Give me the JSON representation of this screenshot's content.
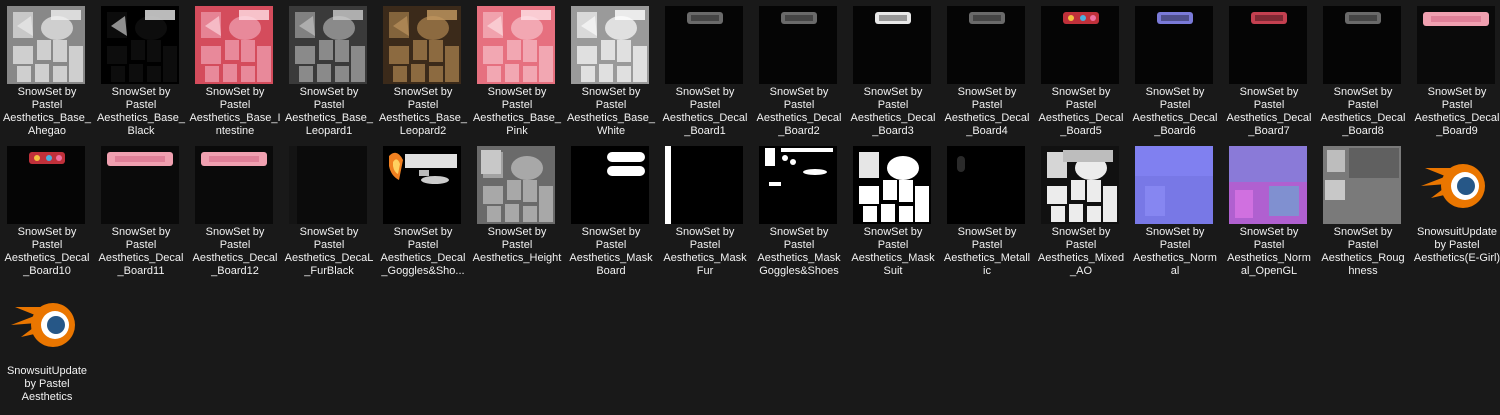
{
  "colors": {
    "background": "#191919",
    "text": "#f2f2f2",
    "blender_orange": "#ea7600",
    "blender_blue": "#265787"
  },
  "files": [
    {
      "name": "SnowSet by Pastel Aesthetics_Base_Ahegao",
      "label": "SnowSet by\nPastel\nAesthetics_Base_\nAhegao",
      "thumb": "texture-gray",
      "icon": "image-thumbnail-icon"
    },
    {
      "name": "SnowSet by Pastel Aesthetics_Base_Black",
      "label": "SnowSet by\nPastel\nAesthetics_Base_\nBlack",
      "thumb": "texture-black",
      "icon": "image-thumbnail-icon"
    },
    {
      "name": "SnowSet by Pastel Aesthetics_Base_Intestine",
      "label": "SnowSet by\nPastel\nAesthetics_Base_I\nntestine",
      "thumb": "texture-red",
      "icon": "image-thumbnail-icon"
    },
    {
      "name": "SnowSet by Pastel Aesthetics_Base_Leopard1",
      "label": "SnowSet by\nPastel\nAesthetics_Base_\nLeopard1",
      "thumb": "texture-darkgray",
      "icon": "image-thumbnail-icon"
    },
    {
      "name": "SnowSet by Pastel Aesthetics_Base_Leopard2",
      "label": "SnowSet by\nPastel\nAesthetics_Base_\nLeopard2",
      "thumb": "texture-brown",
      "icon": "image-thumbnail-icon"
    },
    {
      "name": "SnowSet by Pastel Aesthetics_Base_Pink",
      "label": "SnowSet by\nPastel\nAesthetics_Base_\nPink",
      "thumb": "texture-pink",
      "icon": "image-thumbnail-icon"
    },
    {
      "name": "SnowSet by Pastel Aesthetics_Base_White",
      "label": "SnowSet by\nPastel\nAesthetics_Base_\nWhite",
      "thumb": "texture-white",
      "icon": "image-thumbnail-icon"
    },
    {
      "name": "SnowSet by Pastel Aesthetics_Decal_Board1",
      "label": "SnowSet by\nPastel\nAesthetics_Decal\n_Board1",
      "thumb": "decal-dark",
      "icon": "image-thumbnail-icon"
    },
    {
      "name": "SnowSet by Pastel Aesthetics_Decal_Board2",
      "label": "SnowSet by\nPastel\nAesthetics_Decal\n_Board2",
      "thumb": "decal-dark",
      "icon": "image-thumbnail-icon"
    },
    {
      "name": "SnowSet by Pastel Aesthetics_Decal_Board3",
      "label": "SnowSet by\nPastel\nAesthetics_Decal\n_Board3",
      "thumb": "decal-white",
      "icon": "image-thumbnail-icon"
    },
    {
      "name": "SnowSet by Pastel Aesthetics_Decal_Board4",
      "label": "SnowSet by\nPastel\nAesthetics_Decal\n_Board4",
      "thumb": "decal-dark",
      "icon": "image-thumbnail-icon"
    },
    {
      "name": "SnowSet by Pastel Aesthetics_Decal_Board5",
      "label": "SnowSet by\nPastel\nAesthetics_Decal\n_Board5",
      "thumb": "decal-color",
      "icon": "image-thumbnail-icon"
    },
    {
      "name": "SnowSet by Pastel Aesthetics_Decal_Board6",
      "label": "SnowSet by\nPastel\nAesthetics_Decal\n_Board6",
      "thumb": "decal-blue",
      "icon": "image-thumbnail-icon"
    },
    {
      "name": "SnowSet by Pastel Aesthetics_Decal_Board7",
      "label": "SnowSet by\nPastel\nAesthetics_Decal\n_Board7",
      "thumb": "decal-red",
      "icon": "image-thumbnail-icon"
    },
    {
      "name": "SnowSet by Pastel Aesthetics_Decal_Board8",
      "label": "SnowSet by\nPastel\nAesthetics_Decal\n_Board8",
      "thumb": "decal-dark",
      "icon": "image-thumbnail-icon"
    },
    {
      "name": "SnowSet by Pastel Aesthetics_Decal_Board9",
      "label": "SnowSet by\nPastel\nAesthetics_Decal\n_Board9",
      "thumb": "decal-pink",
      "icon": "image-thumbnail-icon"
    },
    {
      "name": "SnowSet by Pastel Aesthetics_Decal_Board10",
      "label": "SnowSet by\nPastel\nAesthetics_Decal\n_Board10",
      "thumb": "decal-color",
      "icon": "image-thumbnail-icon"
    },
    {
      "name": "SnowSet by Pastel Aesthetics_Decal_Board11",
      "label": "SnowSet by\nPastel\nAesthetics_Decal\n_Board11",
      "thumb": "decal-pink",
      "icon": "image-thumbnail-icon"
    },
    {
      "name": "SnowSet by Pastel Aesthetics_Decal_Board12",
      "label": "SnowSet by\nPastel\nAesthetics_Decal\n_Board12",
      "thumb": "decal-pink",
      "icon": "image-thumbnail-icon"
    },
    {
      "name": "SnowSet by Pastel Aesthetics_DecaL_FurBlack",
      "label": "SnowSet by\nPastel\nAesthetics_DecaL\n_FurBlack",
      "thumb": "fur-black",
      "icon": "image-thumbnail-icon"
    },
    {
      "name": "SnowSet by Pastel Aesthetics_Decal_Goggles&Shoes",
      "label": "SnowSet by\nPastel\nAesthetics_Decal\n_Goggles&Sho...",
      "thumb": "goggles",
      "icon": "image-thumbnail-icon"
    },
    {
      "name": "SnowSet by Pastel Aesthetics_Height",
      "label": "SnowSet by\nPastel\nAesthetics_Height",
      "thumb": "height",
      "icon": "image-thumbnail-icon"
    },
    {
      "name": "SnowSet by Pastel Aesthetics_MaskBoard",
      "label": "SnowSet by\nPastel\nAesthetics_Mask\nBoard",
      "thumb": "mask-board",
      "icon": "image-thumbnail-icon"
    },
    {
      "name": "SnowSet by Pastel Aesthetics_MaskFur",
      "label": "SnowSet by\nPastel\nAesthetics_Mask\nFur",
      "thumb": "mask-fur",
      "icon": "image-thumbnail-icon"
    },
    {
      "name": "SnowSet by Pastel Aesthetics_MaskGoggles&Shoes",
      "label": "SnowSet by\nPastel\nAesthetics_Mask\nGoggles&Shoes",
      "thumb": "mask-goggles",
      "icon": "image-thumbnail-icon"
    },
    {
      "name": "SnowSet by Pastel Aesthetics_MaskSuit",
      "label": "SnowSet by\nPastel\nAesthetics_Mask\nSuit",
      "thumb": "mask-suit",
      "icon": "image-thumbnail-icon"
    },
    {
      "name": "SnowSet by Pastel Aesthetics_Metallic",
      "label": "SnowSet by\nPastel\nAesthetics_Metall\nic",
      "thumb": "metallic",
      "icon": "image-thumbnail-icon"
    },
    {
      "name": "SnowSet by Pastel Aesthetics_Mixed_AO",
      "label": "SnowSet by\nPastel\nAesthetics_Mixed\n_AO",
      "thumb": "mixed-ao",
      "icon": "image-thumbnail-icon"
    },
    {
      "name": "SnowSet by Pastel Aesthetics_Normal",
      "label": "SnowSet by\nPastel\nAesthetics_Norm\nal",
      "thumb": "normal",
      "icon": "image-thumbnail-icon"
    },
    {
      "name": "SnowSet by Pastel Aesthetics_Normal_OpenGL",
      "label": "SnowSet by\nPastel\nAesthetics_Norm\nal_OpenGL",
      "thumb": "normal-gl",
      "icon": "image-thumbnail-icon"
    },
    {
      "name": "SnowSet by Pastel Aesthetics_Roughness",
      "label": "SnowSet by\nPastel\nAesthetics_Roug\nhness",
      "thumb": "roughness",
      "icon": "image-thumbnail-icon"
    },
    {
      "name": "SnowsuitUpdate by Pastel Aesthetics(E-Girl)",
      "label": "SnowsuitUpdate\nby Pastel\nAesthetics(E-Girl)",
      "thumb": "blender",
      "icon": "blender-file-icon"
    },
    {
      "name": "SnowsuitUpdate by Pastel Aesthetics",
      "label": "SnowsuitUpdate\nby Pastel\nAesthetics",
      "thumb": "blender",
      "icon": "blender-file-icon"
    }
  ]
}
